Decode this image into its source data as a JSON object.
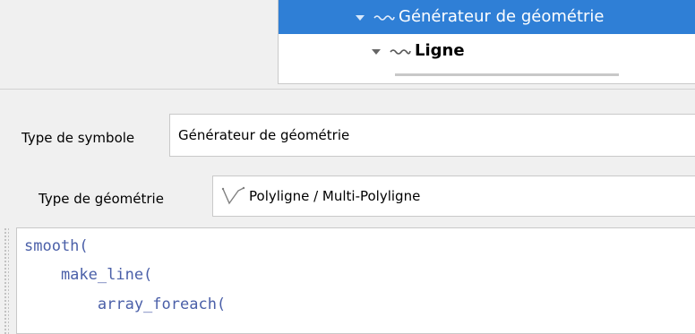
{
  "tree": {
    "items": [
      {
        "label": "Générateur de géométrie",
        "selected": true,
        "icon": "line-symbol-icon"
      },
      {
        "label": "Ligne",
        "selected": false,
        "icon": "line-symbol-icon"
      }
    ]
  },
  "symbol_type": {
    "label": "Type de symbole",
    "value": "Générateur de géométrie"
  },
  "geometry_type": {
    "label": "Type de géométrie",
    "value": "Polyligne / Multi-Polyligne",
    "icon": "polyline-icon"
  },
  "editor": {
    "lines": [
      "smooth(",
      "    make_line(",
      "        array_foreach("
    ]
  },
  "colors": {
    "selection": "#2f7fd6",
    "code_text": "#4a5fa8"
  }
}
